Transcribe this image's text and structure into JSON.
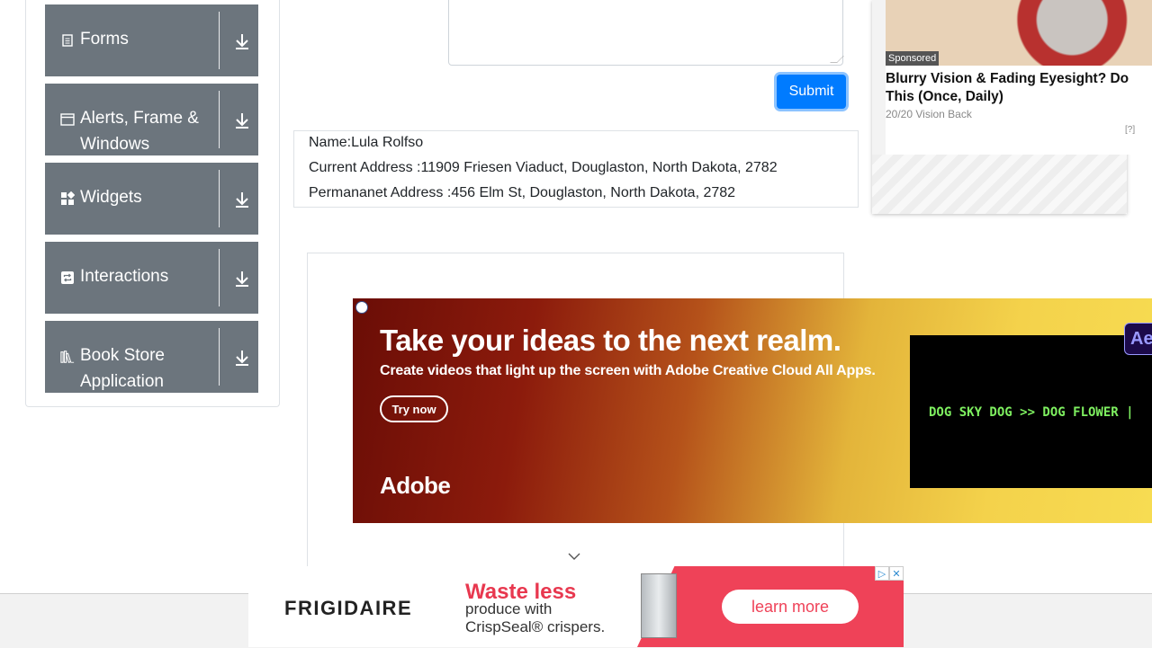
{
  "sidebar": {
    "groups": [
      {
        "label": "Forms",
        "icon": "form-icon"
      },
      {
        "label": "Alerts, Frame & Windows",
        "icon": "window-icon"
      },
      {
        "label": "Widgets",
        "icon": "widgets-icon"
      },
      {
        "label": "Interactions",
        "icon": "interactions-icon"
      },
      {
        "label": "Book Store Application",
        "icon": "books-icon"
      }
    ]
  },
  "form": {
    "submit_label": "Submit"
  },
  "output": {
    "name": "Name:Lula Rolfso",
    "current_address": "Current Address :11909 Friesen Viaduct, Douglaston, North Dakota, 2782",
    "permanent_address": "Permananet Address :456 Elm St, Douglaston, North Dakota, 2782"
  },
  "side_ad": {
    "sponsored": "Sponsored",
    "headline": "Blurry Vision & Fading Eyesight? Do This (Once, Daily)",
    "source": "20/20 Vision Back",
    "help": "[?]"
  },
  "banner_ad": {
    "headline": "Take your ideas to the next realm.",
    "subtitle": "Create videos that light up the screen with Adobe Creative Cloud All Apps.",
    "cta": "Try now",
    "brand": "Adobe",
    "video_text": "DOG SKY DOG >> DOG FLOWER |",
    "app_badge": "Ae"
  },
  "bottom_ad": {
    "brand": "FRIGIDAIRE",
    "headline": "Waste less",
    "line2": "produce with",
    "line3": "CrispSeal® crispers.",
    "cta": "learn more"
  },
  "colors": {
    "sidebar_bg": "#6c757d",
    "primary": "#007bff",
    "ad_pink": "#ef4258"
  }
}
